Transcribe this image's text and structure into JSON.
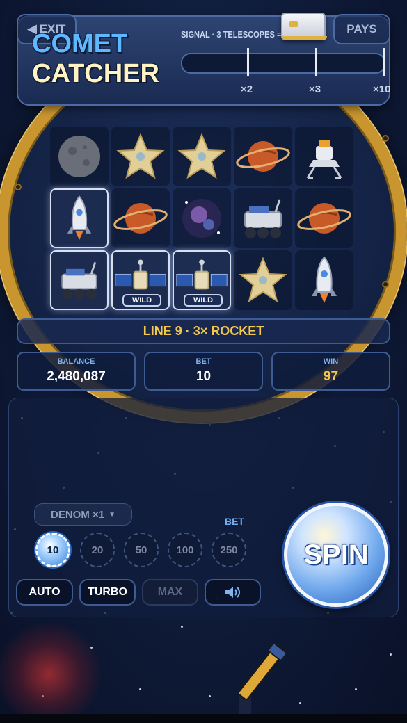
{
  "header": {
    "exit_label": "EXIT",
    "pays_label": "PAYS",
    "logo_line1": "COMET",
    "logo_line2": "CATCHER",
    "signal_label": "SIGNAL · 3 TELESCOPES = METEOR",
    "multipliers": [
      "×2",
      "×3",
      "×10"
    ]
  },
  "reels": {
    "grid": [
      [
        "moon",
        "star",
        "star",
        "planet",
        "lander"
      ],
      [
        "rocket",
        "planet",
        "nebula",
        "rover",
        "planet"
      ],
      [
        "rover",
        "satellite",
        "satellite",
        "star",
        "rocket"
      ]
    ],
    "highlighted": [
      [
        1,
        0
      ],
      [
        2,
        0
      ],
      [
        2,
        1
      ],
      [
        2,
        2
      ]
    ],
    "wild_label": "WILD"
  },
  "win_line": "LINE 9 · 3× ROCKET",
  "stats": {
    "balance_label": "BALANCE",
    "balance_value": "2,480,087",
    "bet_label": "BET",
    "bet_value": "10",
    "win_label": "WIN",
    "win_value": "97"
  },
  "controls": {
    "denom_label": "DENOM ×1",
    "bet_label": "BET",
    "bet_options": [
      "10",
      "20",
      "50",
      "100",
      "250"
    ],
    "selected_bet": "10",
    "auto_label": "AUTO",
    "turbo_label": "TURBO",
    "max_label": "MAX",
    "sound_icon": "speaker-icon",
    "spin_label": "SPIN"
  },
  "colors": {
    "accent_gold": "#f4c84a",
    "accent_blue": "#6fb0f5",
    "ring_gold": "#c8952e"
  }
}
